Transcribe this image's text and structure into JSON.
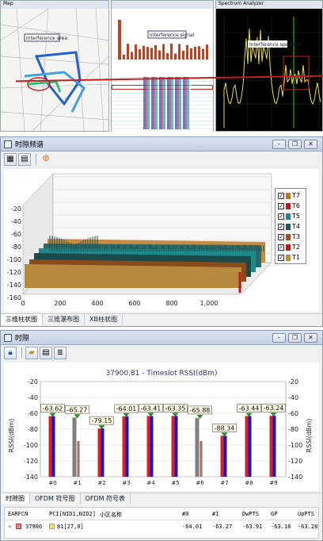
{
  "top": {
    "map": {
      "title": "Map",
      "label": "Interference area"
    },
    "bar": {
      "title": "",
      "label": "Interference signal"
    },
    "spectrum": {
      "title": "Spectrum Analyzer",
      "label": "Interference spectrum"
    }
  },
  "waterfall": {
    "title": "时隙频谱",
    "y_ticks": [
      "-20",
      "-40",
      "-60",
      "-80",
      "-100",
      "-120",
      "-140",
      "-160"
    ],
    "x_ticks": [
      "0",
      "200",
      "400",
      "600",
      "800",
      "1,000"
    ],
    "legend": [
      {
        "label": "T7",
        "color": "#c07820"
      },
      {
        "label": "T6",
        "color": "#c01818"
      },
      {
        "label": "T5",
        "color": "#1c8a8a"
      },
      {
        "label": "T4",
        "color": "#1a5a5a"
      },
      {
        "label": "T3",
        "color": "#a05020"
      },
      {
        "label": "T2",
        "color": "#c01818"
      },
      {
        "label": "T1",
        "color": "#b88a40"
      }
    ],
    "tabs": [
      "三维柱状图",
      "三维瀑布图",
      "XB柱状图"
    ]
  },
  "timeslot": {
    "title": "时隙",
    "chart_title": "37900,81 - Timeslot RSSI(dBm)",
    "tabs": [
      "时隙图",
      "OFDM 符号图",
      "OFDM 符号表"
    ],
    "table": {
      "headers": [
        "EARFCN",
        "PCI[NID1,NID2]",
        "小区名称",
        "#0",
        "#1",
        "DwPTS",
        "GP",
        "UpPTS"
      ],
      "row": {
        "earfcn": "37900",
        "pci": "81[27,0]",
        "name": "",
        "c0": "-64.01",
        "c1": "-63.27",
        "dwpts": "-63.91",
        "gp": "-63.18",
        "uppts": "-63.28"
      }
    }
  },
  "chart_data": {
    "type": "bar",
    "title": "37900,81 - Timeslot RSSI(dBm)",
    "ylabel": "RSSI(dBm)",
    "ylim": [
      -140,
      -20
    ],
    "y_ticks": [
      -20,
      -40,
      -60,
      -80,
      -100,
      -120,
      -140
    ],
    "categories": [
      "#0",
      "#1",
      "#2",
      "#3",
      "#4",
      "#5",
      "#6",
      "#7",
      "#8",
      "#9"
    ],
    "labels": [
      "-63.62",
      "-65.27",
      "-79.15",
      "-64.01",
      "-63.41",
      "-63.35",
      "-65.88",
      "-88.34",
      "-63.44",
      "-63.24"
    ],
    "series": [
      {
        "values": [
          -63.62,
          -65.27,
          -79.15,
          -64.01,
          -63.41,
          -63.35,
          -65.88,
          -88.34,
          -63.44,
          -63.24
        ]
      }
    ],
    "colors": {
      "red": "#e02020",
      "blue": "#1818c8",
      "gray": "#808080",
      "brown": "#a07060",
      "green": "#2a8a2a"
    }
  }
}
